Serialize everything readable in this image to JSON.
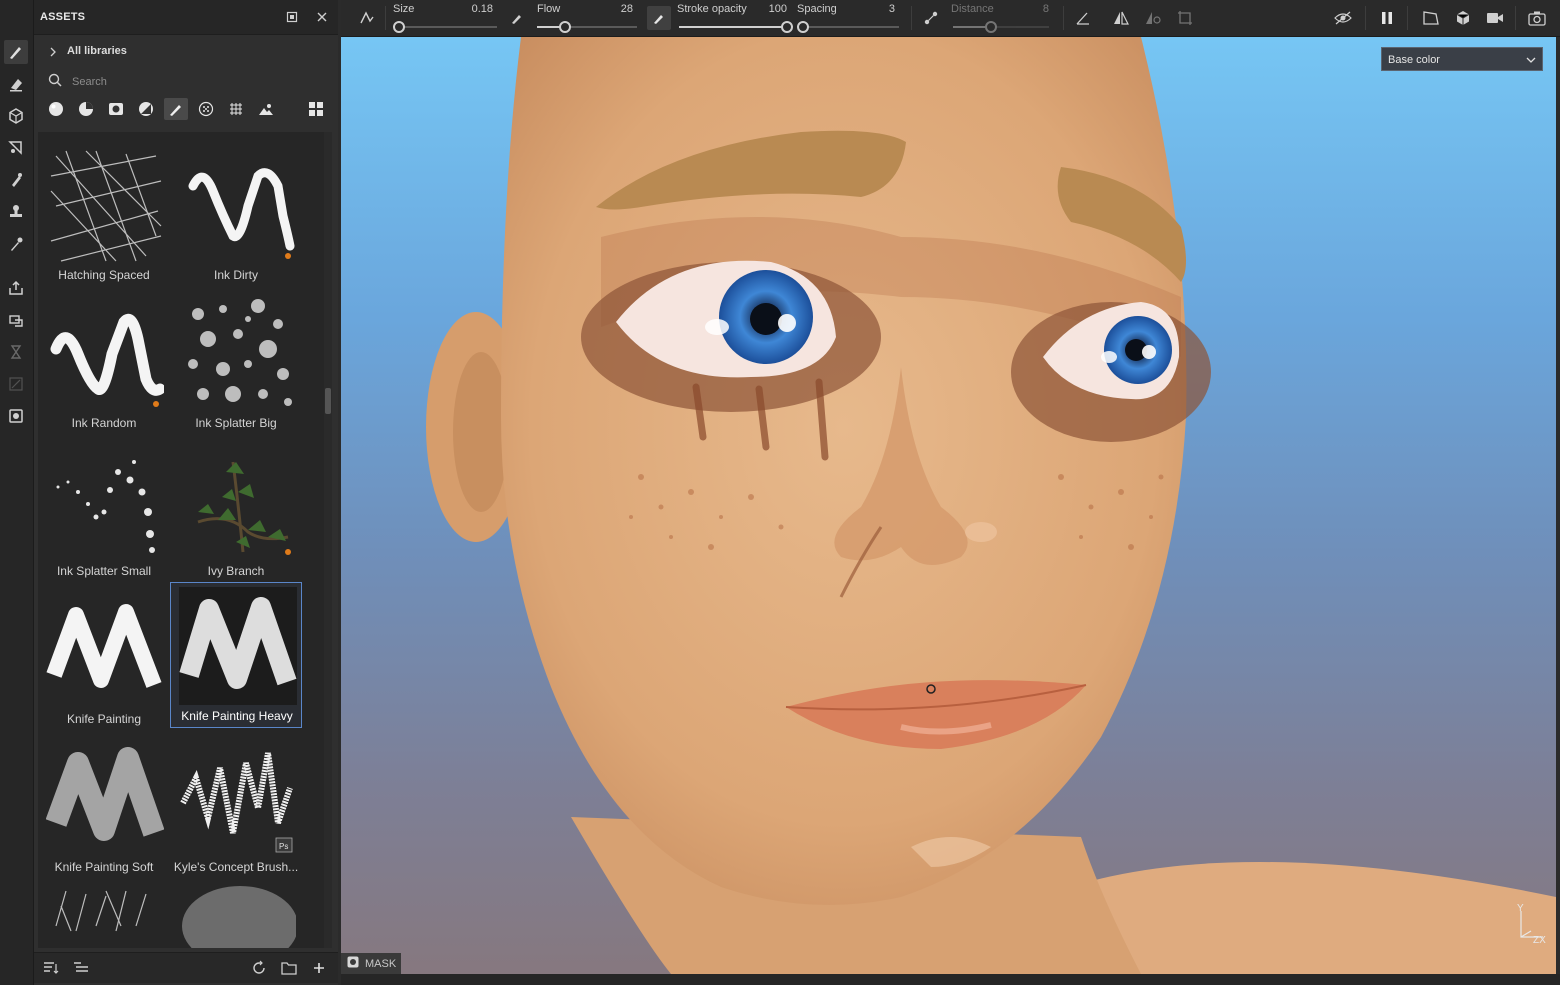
{
  "assets": {
    "title": "ASSETS",
    "libraries_label": "All libraries",
    "search_placeholder": "Search",
    "items": [
      {
        "label": "Hatching Spaced"
      },
      {
        "label": "Ink Dirty"
      },
      {
        "label": "Ink Random"
      },
      {
        "label": "Ink Splatter Big"
      },
      {
        "label": "Ink Splatter Small"
      },
      {
        "label": "Ivy Branch"
      },
      {
        "label": "Knife Painting"
      },
      {
        "label": "Knife Painting Heavy"
      },
      {
        "label": "Knife Painting Soft"
      },
      {
        "label": "Kyle's Concept Brush..."
      }
    ],
    "selected_item": "Knife Painting Heavy",
    "ps_badge": "Ps"
  },
  "toolbar": {
    "size_label": "Size",
    "size_value": "0.18",
    "flow_label": "Flow",
    "flow_value": "28",
    "stroke_opacity_label": "Stroke opacity",
    "stroke_opacity_value": "100",
    "spacing_label": "Spacing",
    "spacing_value": "3",
    "distance_label": "Distance",
    "distance_value": "8"
  },
  "sliders": {
    "size": 0.0,
    "flow": 0.28,
    "stroke_opacity": 1.0,
    "spacing": 0.0,
    "distance": 0.4
  },
  "viewport": {
    "channel_select": "Base color",
    "mask_label": "MASK",
    "axis_y": "Y",
    "axis_zx": "ZX"
  },
  "colors": {
    "accent_selected": "#5a86c9",
    "panel_bg": "#2f2f2f",
    "brush_badge": "#e07b1a"
  }
}
